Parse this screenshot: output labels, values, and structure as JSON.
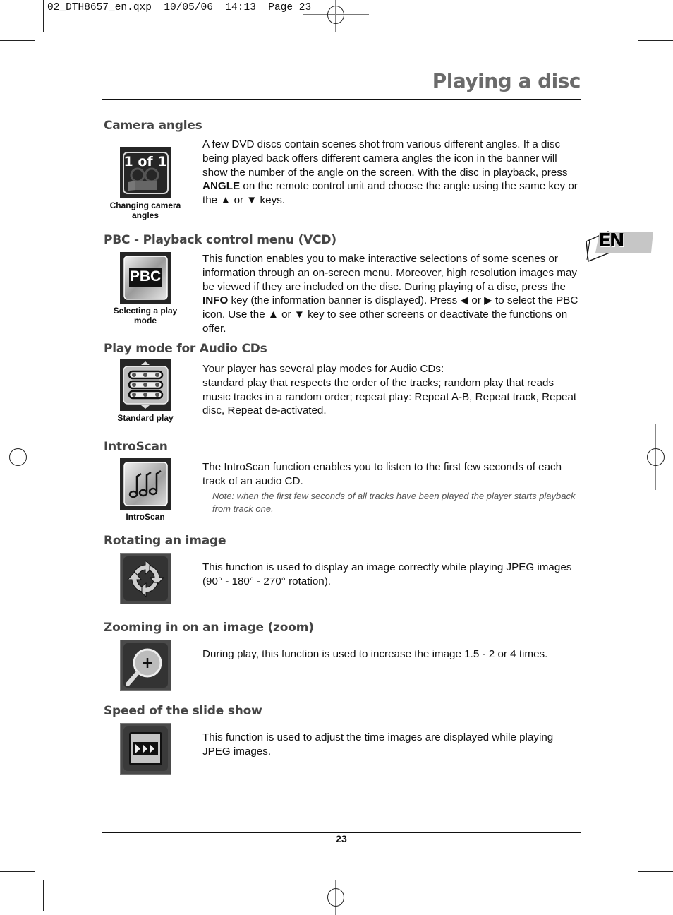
{
  "print_slug": "02_DTH8657_en.qxp  10/05/06  14:13  Page 23",
  "page_title": "Playing a disc",
  "language_tab": "EN",
  "page_number": "23",
  "sections": [
    {
      "heading": "Camera angles",
      "icon": "camera-angle-icon",
      "icon_text": "1 of 1",
      "caption": "Changing camera angles",
      "body_1": "A few DVD discs contain scenes shot from various different angles. If a disc being played back offers different camera angles the icon in the banner will show the number of the angle on the screen. With the disc in playback, press ",
      "bold_1": "ANGLE",
      "body_2": " on the remote control unit and choose the angle using the same key or the ▲ or ▼ keys."
    },
    {
      "heading": "PBC - Playback control menu (VCD)",
      "icon": "pbc-icon",
      "icon_text": "PBC",
      "caption": "Selecting a play mode",
      "body_1": "This function enables you to make interactive selections of some scenes or information through an on-screen menu. Moreover, high resolution images may be viewed if they are included on the disc. During playing of a disc, press the ",
      "bold_1": "INFO",
      "body_2": " key (the information banner is displayed). Press ◀ or ▶ to select the PBC icon. Use the ▲ or ▼ key to see other screens or deactivate the functions on offer."
    },
    {
      "heading": "Play mode for Audio CDs",
      "icon": "standard-play-icon",
      "caption": "Standard play",
      "body_line_1": "Your player has several play modes for Audio CDs:",
      "body_line_2": "standard play that respects the order of the tracks; random play that reads music tracks in a random order; repeat play: Repeat A-B, Repeat track, Repeat disc, Repeat de-activated."
    },
    {
      "heading": "IntroScan",
      "icon": "introscan-icon",
      "caption": "IntroScan",
      "body": "The IntroScan function enables you to listen to the first few seconds of each track of an audio CD.",
      "note": "Note: when the first few seconds of all tracks have been played the player starts playback from track one."
    },
    {
      "heading": "Rotating an image",
      "icon": "rotate-icon",
      "body": "This function is used to display an image correctly while playing JPEG images (90° - 180° - 270° rotation)."
    },
    {
      "heading": "Zooming in on an image (zoom)",
      "icon": "zoom-icon",
      "body": "During play, this function is used to increase the image 1.5 - 2 or 4 times."
    },
    {
      "heading": "Speed of the slide show",
      "icon": "slideshow-speed-icon",
      "body": "This function is used to adjust the time images are displayed while playing JPEG images."
    }
  ]
}
